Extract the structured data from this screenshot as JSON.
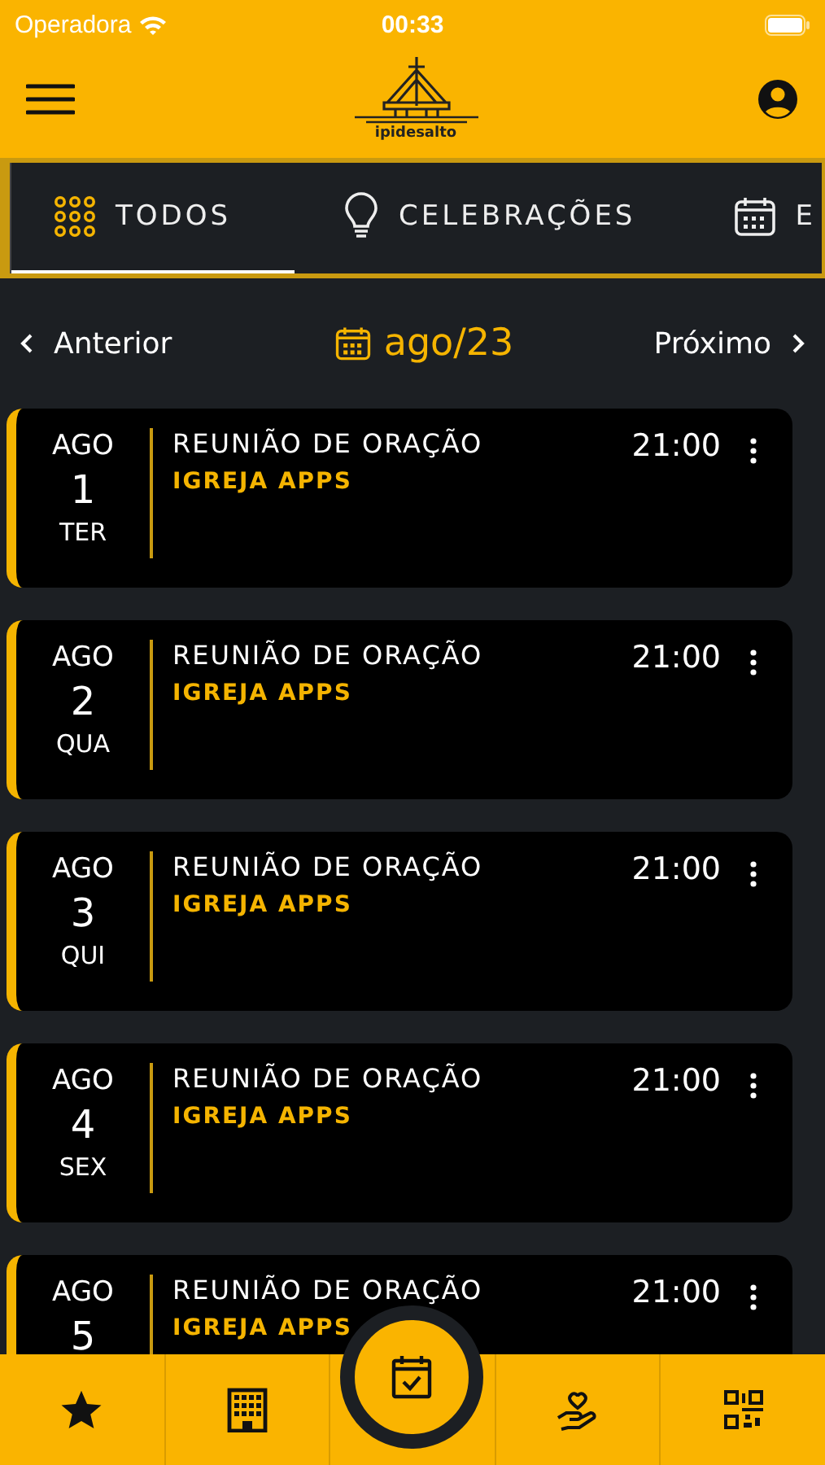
{
  "status_bar": {
    "carrier": "Operadora",
    "time": "00:33"
  },
  "header": {
    "logo_text": "ipidesalto"
  },
  "tabs": [
    {
      "label": "TODOS",
      "kind": "grid",
      "selected": true
    },
    {
      "label": "CELEBRAÇÕES",
      "kind": "bulb",
      "selected": false
    },
    {
      "label": "E",
      "kind": "calendar",
      "selected": false
    }
  ],
  "month_nav": {
    "previous": "Anterior",
    "month": "ago/23",
    "next": "Próximo"
  },
  "events": [
    {
      "month": "AGO",
      "day": "1",
      "weekday": "TER",
      "title": "REUNIÃO DE ORAÇÃO",
      "organizer": "IGREJA APPS",
      "time": "21:00"
    },
    {
      "month": "AGO",
      "day": "2",
      "weekday": "QUA",
      "title": "REUNIÃO DE ORAÇÃO",
      "organizer": "IGREJA APPS",
      "time": "21:00"
    },
    {
      "month": "AGO",
      "day": "3",
      "weekday": "QUI",
      "title": "REUNIÃO DE ORAÇÃO",
      "organizer": "IGREJA APPS",
      "time": "21:00"
    },
    {
      "month": "AGO",
      "day": "4",
      "weekday": "SEX",
      "title": "REUNIÃO DE ORAÇÃO",
      "organizer": "IGREJA APPS",
      "time": "21:00"
    },
    {
      "month": "AGO",
      "day": "5",
      "title": "REUNIÃO DE ORAÇÃO",
      "organizer": "IGREJA APPS",
      "time": "21:00"
    }
  ],
  "bottom_nav": [
    {
      "kind": "star",
      "selected": false
    },
    {
      "kind": "building",
      "selected": false
    },
    {
      "kind": "calendar-check",
      "selected": true
    },
    {
      "kind": "hand-heart",
      "selected": false
    },
    {
      "kind": "qr",
      "selected": false
    }
  ]
}
